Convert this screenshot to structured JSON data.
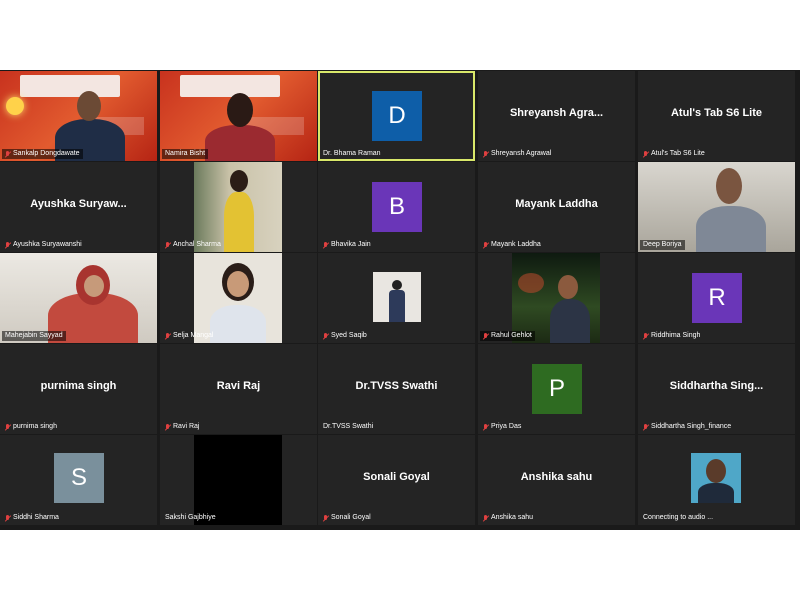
{
  "participants": [
    {
      "label": "Sankalp Dongdawate",
      "muted": true
    },
    {
      "label": "Namira Bisht",
      "muted": false
    },
    {
      "label": "Dr. Bhama Raman",
      "muted": false,
      "avatar_letter": "D",
      "avatar_color": "#0e5ea8"
    },
    {
      "label": "Shreyansh Agrawal",
      "muted": true,
      "center_name": "Shreyansh  Agra..."
    },
    {
      "label": "Atul's Tab S6 Lite",
      "muted": true,
      "center_name": "Atul's Tab S6 Lite"
    },
    {
      "label": "Ayushka Suryawanshi",
      "muted": true,
      "center_name": "Ayushka  Suryaw..."
    },
    {
      "label": "Anchal Sharma",
      "muted": true
    },
    {
      "label": "Bhavika Jain",
      "muted": true,
      "avatar_letter": "B",
      "avatar_color": "#6a36b8"
    },
    {
      "label": "Mayank Laddha",
      "muted": true,
      "center_name": "Mayank Laddha"
    },
    {
      "label": "Deep Boriya",
      "muted": false
    },
    {
      "label": "Mahejabin Sayyad",
      "muted": false
    },
    {
      "label": "Selja Mangal",
      "muted": true
    },
    {
      "label": "Syed Saqib",
      "muted": true
    },
    {
      "label": "Rahul Gehlot",
      "muted": true
    },
    {
      "label": "Riddhima Singh",
      "muted": true,
      "avatar_letter": "R",
      "avatar_color": "#6a36b8"
    },
    {
      "label": "purnima singh",
      "muted": true,
      "center_name": "purnima singh"
    },
    {
      "label": "Ravi Raj",
      "muted": true,
      "center_name": "Ravi Raj"
    },
    {
      "label": "Dr.TVSS Swathi",
      "muted": false,
      "center_name": "Dr.TVSS Swathi"
    },
    {
      "label": "Priya Das",
      "muted": true,
      "avatar_letter": "P",
      "avatar_color": "#2e6b21"
    },
    {
      "label": "Siddhartha Singh_finance",
      "muted": true,
      "center_name": "Siddhartha  Sing..."
    },
    {
      "label": "Siddhi Sharma",
      "muted": true,
      "avatar_letter": "S",
      "avatar_color": "#7a909c"
    },
    {
      "label": "Sakshi Gajbhiye",
      "muted": false
    },
    {
      "label": "Sonali Goyal",
      "muted": true,
      "center_name": "Sonali Goyal"
    },
    {
      "label": "Anshika sahu",
      "muted": true,
      "center_name": "Anshika sahu"
    },
    {
      "label": "Connecting to audio ...",
      "muted": false
    }
  ],
  "colors": {
    "background": "#1a1a1a",
    "tile": "#242424",
    "active_border": "#d9e86a",
    "muted_icon": "#e04040"
  }
}
